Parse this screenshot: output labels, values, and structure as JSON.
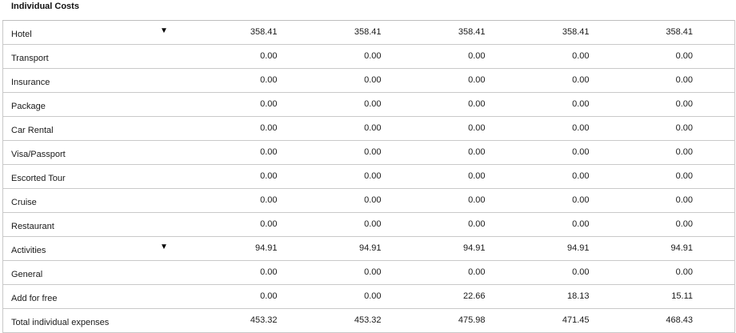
{
  "section": {
    "title": "Individual Costs"
  },
  "rows": [
    {
      "label": "Hotel",
      "has_dropdown": true,
      "values": [
        "358.41",
        "358.41",
        "358.41",
        "358.41",
        "358.41"
      ]
    },
    {
      "label": "Transport",
      "has_dropdown": false,
      "values": [
        "0.00",
        "0.00",
        "0.00",
        "0.00",
        "0.00"
      ]
    },
    {
      "label": "Insurance",
      "has_dropdown": false,
      "values": [
        "0.00",
        "0.00",
        "0.00",
        "0.00",
        "0.00"
      ]
    },
    {
      "label": "Package",
      "has_dropdown": false,
      "values": [
        "0.00",
        "0.00",
        "0.00",
        "0.00",
        "0.00"
      ]
    },
    {
      "label": "Car Rental",
      "has_dropdown": false,
      "values": [
        "0.00",
        "0.00",
        "0.00",
        "0.00",
        "0.00"
      ]
    },
    {
      "label": "Visa/Passport",
      "has_dropdown": false,
      "values": [
        "0.00",
        "0.00",
        "0.00",
        "0.00",
        "0.00"
      ]
    },
    {
      "label": "Escorted Tour",
      "has_dropdown": false,
      "values": [
        "0.00",
        "0.00",
        "0.00",
        "0.00",
        "0.00"
      ]
    },
    {
      "label": "Cruise",
      "has_dropdown": false,
      "values": [
        "0.00",
        "0.00",
        "0.00",
        "0.00",
        "0.00"
      ]
    },
    {
      "label": "Restaurant",
      "has_dropdown": false,
      "values": [
        "0.00",
        "0.00",
        "0.00",
        "0.00",
        "0.00"
      ]
    },
    {
      "label": "Activities",
      "has_dropdown": true,
      "values": [
        "94.91",
        "94.91",
        "94.91",
        "94.91",
        "94.91"
      ]
    },
    {
      "label": "General",
      "has_dropdown": false,
      "values": [
        "0.00",
        "0.00",
        "0.00",
        "0.00",
        "0.00"
      ]
    },
    {
      "label": "Add for free",
      "has_dropdown": false,
      "values": [
        "0.00",
        "0.00",
        "22.66",
        "18.13",
        "15.11"
      ]
    },
    {
      "label": "Total individual expenses",
      "has_dropdown": false,
      "values": [
        "453.32",
        "453.32",
        "475.98",
        "471.45",
        "468.43"
      ]
    }
  ],
  "icons": {
    "dropdown": "caret-down-icon",
    "dropdown_glyph": "▼"
  }
}
